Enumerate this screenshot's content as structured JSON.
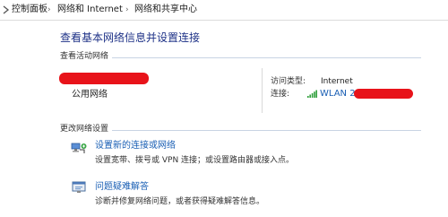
{
  "breadcrumb": {
    "items": [
      "控制面板",
      "网络和 Internet",
      "网络和共享中心"
    ],
    "separator": "›"
  },
  "page": {
    "title": "查看基本网络信息并设置连接"
  },
  "active_networks": {
    "header": "查看活动网络",
    "network_category": "公用网络",
    "access_type_label": "访问类型:",
    "access_type_value": "Internet",
    "connection_label": "连接:",
    "connection_value": "WLAN 2"
  },
  "change_settings": {
    "header": "更改网络设置",
    "tasks": [
      {
        "link": "设置新的连接或网络",
        "description": "设置宽带、拨号或 VPN 连接；或设置路由器或接入点。",
        "icon": "new-connection-icon"
      },
      {
        "link": "问题疑难解答",
        "description": "诊断并修复网络问题，或者获得疑难解答信息。",
        "icon": "troubleshoot-icon"
      }
    ]
  },
  "colors": {
    "title": "#1e3287",
    "link": "#1a5fb4",
    "redaction": "#e8131a",
    "rule": "#c8d4e3"
  }
}
